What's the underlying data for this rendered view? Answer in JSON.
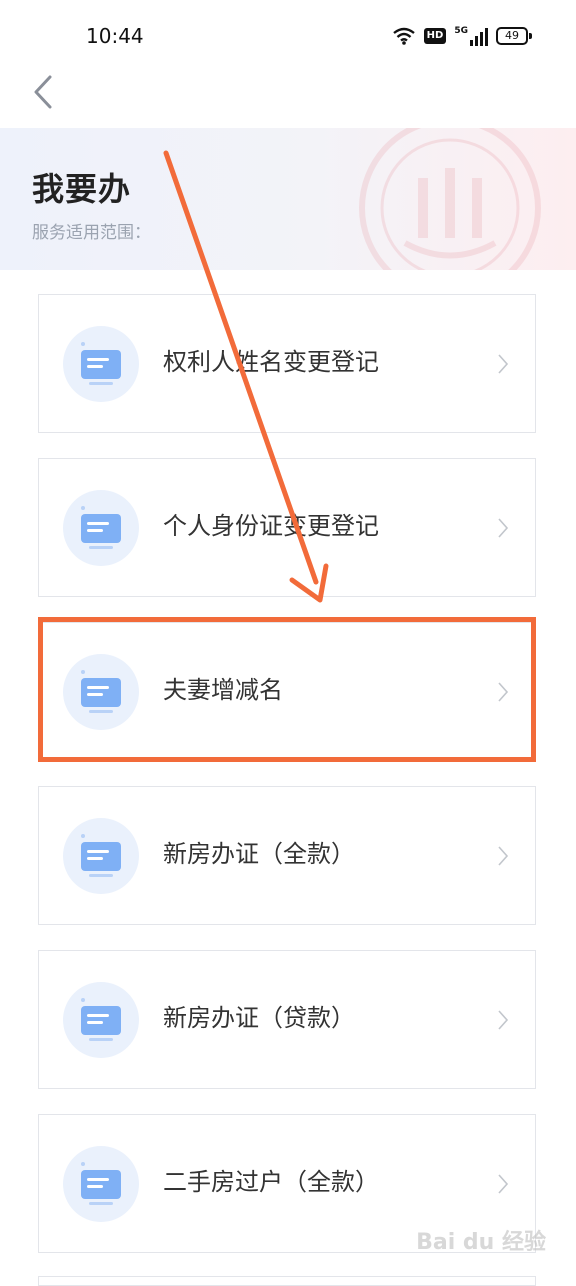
{
  "status_bar": {
    "time": "10:44",
    "network_label": "5G",
    "hd_label": "HD",
    "battery_level": "49"
  },
  "header": {
    "title": "我要办",
    "scope_label": "服务适用范围："
  },
  "services": [
    {
      "label": "权利人姓名变更登记"
    },
    {
      "label": "个人身份证变更登记"
    },
    {
      "label": "夫妻增减名"
    },
    {
      "label": "新房办证（全款）"
    },
    {
      "label": "新房办证（贷款）"
    },
    {
      "label": "二手房过户（全款）"
    }
  ],
  "colors": {
    "accent": "#f26b3a",
    "icon_blue": "#7fb0f5",
    "icon_bg": "#eaf1fc"
  },
  "watermark": "Bai du 经验"
}
